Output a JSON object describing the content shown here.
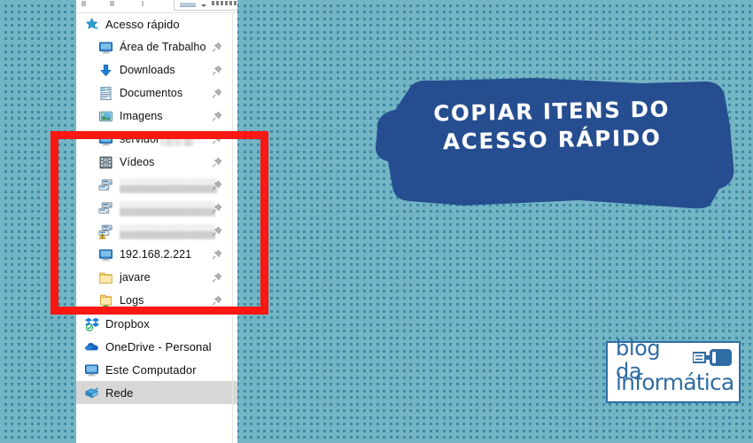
{
  "colors": {
    "wallpaper_base": "#3d8ba5",
    "wallpaper_stripe": "#74b5c5",
    "banner_blue": "#254d8f",
    "highlight_red": "#fb1712",
    "logo_blue": "#2f6ca3",
    "selected_row": "#d7d7d7"
  },
  "banner": {
    "line1": "COPIAR ITENS DO",
    "line2": "ACESSO RÁPIDO"
  },
  "logo": {
    "line1": "blog da",
    "line2": "informática",
    "icon": "usb-flash-drive-icon"
  },
  "explorer": {
    "toolbar": {
      "dropdown_label": ""
    },
    "nav_items": [
      {
        "label": "Acesso rápido",
        "icon": "star-pinned-icon",
        "indent": 0,
        "pinned": false,
        "selected": false,
        "censored": false
      },
      {
        "label": "Área de Trabalho",
        "icon": "desktop-monitor-icon",
        "indent": 1,
        "pinned": true,
        "selected": false,
        "censored": false
      },
      {
        "label": "Downloads",
        "icon": "download-arrow-icon",
        "indent": 1,
        "pinned": true,
        "selected": false,
        "censored": false
      },
      {
        "label": "Documentos",
        "icon": "documents-icon",
        "indent": 1,
        "pinned": true,
        "selected": false,
        "censored": false
      },
      {
        "label": "Imagens",
        "icon": "pictures-icon",
        "indent": 1,
        "pinned": true,
        "selected": false,
        "censored": false
      },
      {
        "label": "servidor",
        "icon": "network-computer-icon",
        "indent": 1,
        "pinned": true,
        "selected": false,
        "censored": true,
        "censor_width": 38
      },
      {
        "label": "Vídeos",
        "icon": "videos-folder-icon",
        "indent": 1,
        "pinned": true,
        "selected": false,
        "censored": false
      },
      {
        "label": "",
        "icon": "network-drive-icon",
        "indent": 1,
        "pinned": true,
        "selected": false,
        "censored": true,
        "censor_width": 110,
        "censor_style": "two"
      },
      {
        "label": "",
        "icon": "network-drive-icon",
        "indent": 1,
        "pinned": true,
        "selected": false,
        "censored": true,
        "censor_width": 108,
        "censor_style": "two"
      },
      {
        "label": "",
        "icon": "network-drive-warning-icon",
        "indent": 1,
        "pinned": true,
        "selected": false,
        "censored": true,
        "censor_width": 108,
        "censor_style": "two"
      },
      {
        "label": "192.168.2.221",
        "icon": "network-computer-icon",
        "indent": 1,
        "pinned": true,
        "selected": false,
        "censored": false
      },
      {
        "label": "javare",
        "icon": "folder-icon",
        "indent": 1,
        "pinned": true,
        "selected": false,
        "censored": false
      },
      {
        "label": "Logs",
        "icon": "folder-shared-icon",
        "indent": 1,
        "pinned": true,
        "selected": false,
        "censored": false
      },
      {
        "label": "Dropbox",
        "icon": "dropbox-icon",
        "indent": 0,
        "pinned": false,
        "selected": false,
        "censored": false
      },
      {
        "label": "OneDrive - Personal",
        "icon": "onedrive-cloud-icon",
        "indent": 0,
        "pinned": false,
        "selected": false,
        "censored": false
      },
      {
        "label": "Este Computador",
        "icon": "this-pc-icon",
        "indent": 0,
        "pinned": false,
        "selected": false,
        "censored": false
      },
      {
        "label": "Rede",
        "icon": "network-icon",
        "indent": 0,
        "pinned": false,
        "selected": true,
        "censored": false
      }
    ]
  },
  "annotation": {
    "highlight_shape": "red-rectangle",
    "highlights_items_from": "servidor",
    "highlights_items_to": "Logs"
  }
}
